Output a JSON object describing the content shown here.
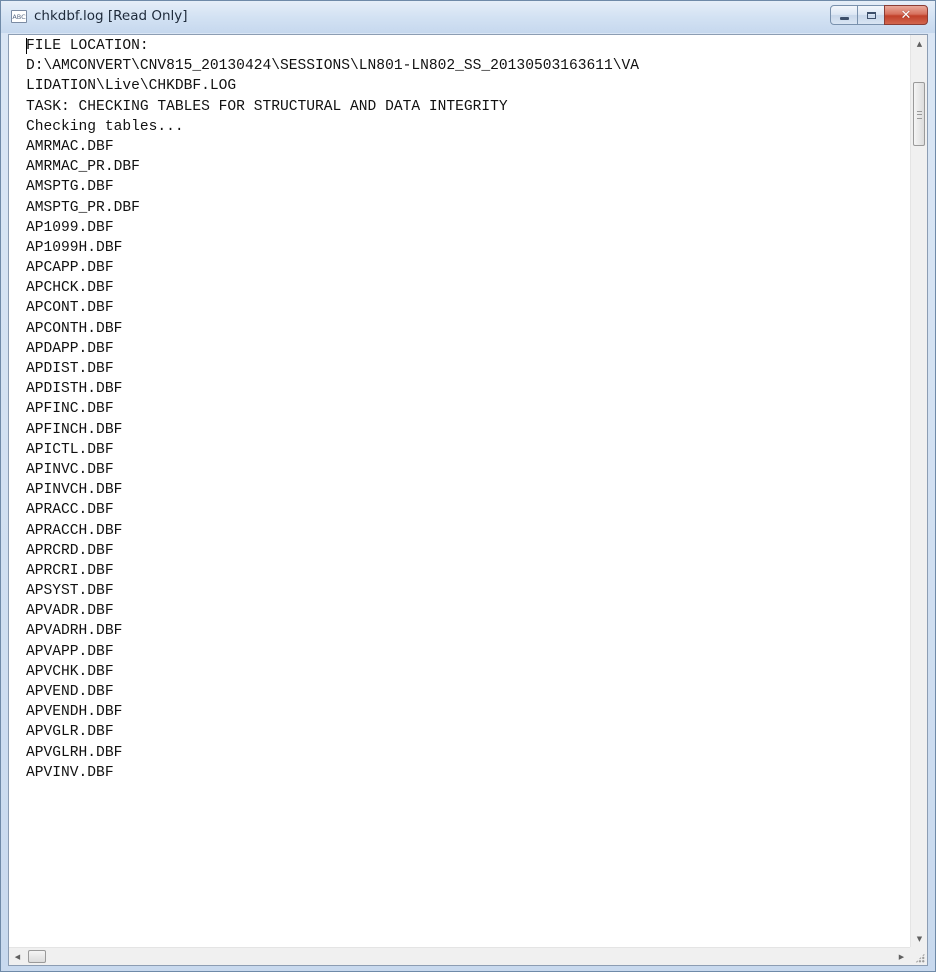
{
  "window": {
    "title": "chkdbf.log [Read Only]",
    "app_icon_label": "ABC",
    "controls": {
      "minimize": "minimize-icon",
      "maximize": "maximize-icon",
      "close": "✕"
    }
  },
  "log": {
    "lines": [
      "FILE LOCATION:",
      "D:\\AMCONVERT\\CNV815_20130424\\SESSIONS\\LN801-LN802_SS_20130503163611\\VA",
      "LIDATION\\Live\\CHKDBF.LOG",
      "TASK: CHECKING TABLES FOR STRUCTURAL AND DATA INTEGRITY",
      "Checking tables...",
      "AMRMAC.DBF",
      "AMRMAC_PR.DBF",
      "AMSPTG.DBF",
      "AMSPTG_PR.DBF",
      "AP1099.DBF",
      "AP1099H.DBF",
      "APCAPP.DBF",
      "APCHCK.DBF",
      "APCONT.DBF",
      "APCONTH.DBF",
      "APDAPP.DBF",
      "APDIST.DBF",
      "APDISTH.DBF",
      "APFINC.DBF",
      "APFINCH.DBF",
      "APICTL.DBF",
      "APINVC.DBF",
      "APINVCH.DBF",
      "APRACC.DBF",
      "APRACCH.DBF",
      "APRCRD.DBF",
      "APRCRI.DBF",
      "APSYST.DBF",
      "APVADR.DBF",
      "APVADRH.DBF",
      "APVAPP.DBF",
      "APVCHK.DBF",
      "APVEND.DBF",
      "APVENDH.DBF",
      "APVGLR.DBF",
      "APVGLRH.DBF",
      "APVINV.DBF"
    ]
  },
  "scrollbars": {
    "up_arrow": "▲",
    "down_arrow": "▼",
    "left_arrow": "◀",
    "right_arrow": "▶"
  }
}
